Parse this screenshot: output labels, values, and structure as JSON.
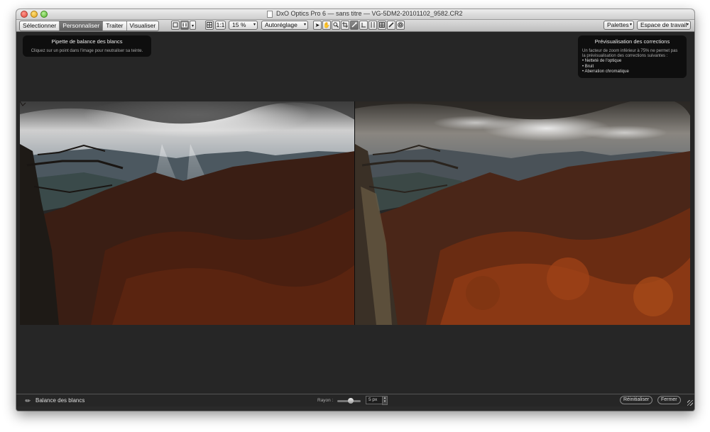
{
  "window": {
    "title": "DxO Optics Pro 6 — sans titre — VG-5DM2-20101102_9582.CR2"
  },
  "toolbar": {
    "modes": [
      "Sélectionner",
      "Personnaliser",
      "Traiter",
      "Visualiser"
    ],
    "active_mode": "Personnaliser",
    "zoom_fit_label": "1:1",
    "zoom_value": "15 %",
    "preset_label": "Autoréglage",
    "palettes_label": "Palettes",
    "workspace_label": "Espace de travail"
  },
  "hud_left": {
    "title": "Pipette de balance des blancs",
    "text": "Cliquez sur un point dans l'image pour neutraliser sa teinte."
  },
  "hud_right": {
    "title": "Prévisualisation des corrections",
    "text_line1": "Un facteur de zoom inférieur à 75% ne permet pas",
    "text_line2": "la prévisualisation des corrections suivantes :",
    "items": [
      "Netteté de l'optique",
      "Bruit",
      "Aberration chromatique"
    ]
  },
  "bottombar": {
    "tool_label": "Balance des blancs",
    "radius_label": "Rayon :",
    "radius_value": "5 px",
    "reset_label": "Réinitialiser",
    "close_label": "Fermer"
  },
  "colors": {
    "window_bg": "#2a2a2a",
    "hud_bg": "#0c0c0c",
    "active_tab": "#6a6a6a"
  }
}
